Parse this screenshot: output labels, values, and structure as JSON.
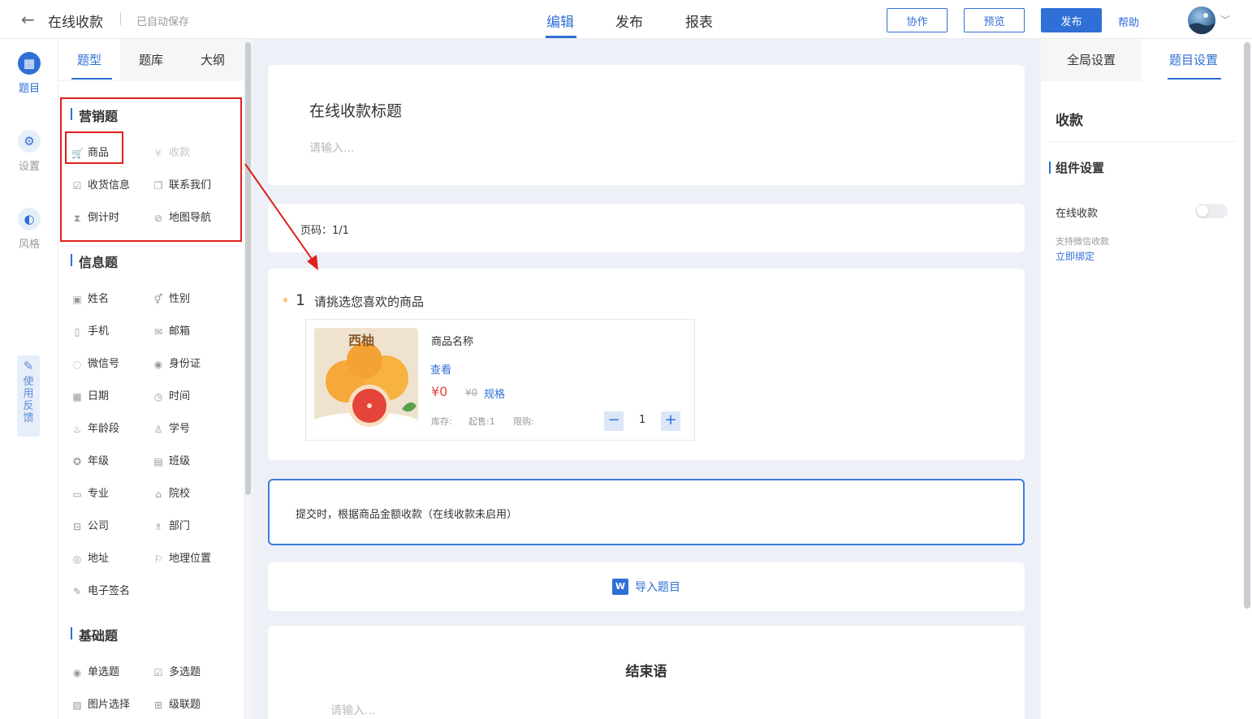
{
  "header": {
    "title": "在线收款",
    "autosave": "已自动保存",
    "tabs": [
      "编辑",
      "发布",
      "报表"
    ],
    "collab_label": "协作",
    "preview_label": "预览",
    "publish_label": "发布",
    "help_label": "帮助"
  },
  "rail": {
    "items": [
      "题目",
      "设置",
      "风格"
    ],
    "feedback": "使用反馈"
  },
  "panel": {
    "tabs": [
      "题型",
      "题库",
      "大纲"
    ],
    "sections": [
      {
        "title": "营销题",
        "items": [
          "商品",
          "收款",
          "收货信息",
          "联系我们",
          "倒计时",
          "地图导航"
        ]
      },
      {
        "title": "信息题",
        "items": [
          "姓名",
          "性别",
          "手机",
          "邮箱",
          "微信号",
          "身份证",
          "日期",
          "时间",
          "年龄段",
          "学号",
          "年级",
          "班级",
          "专业",
          "院校",
          "公司",
          "部门",
          "地址",
          "地理位置",
          "电子签名"
        ]
      },
      {
        "title": "基础题",
        "items": [
          "单选题",
          "多选题",
          "图片选择",
          "级联题"
        ]
      }
    ]
  },
  "form": {
    "title": "在线收款标题",
    "desc_placeholder": "请输入...",
    "page_no": "页码：1/1",
    "question": {
      "star": "*",
      "number": "1",
      "text": "请挑选您喜欢的商品"
    },
    "product": {
      "image_text": "西柚",
      "name": "商品名称",
      "view": "查看",
      "price": "¥0",
      "orig_price": "¥0",
      "spec": "规格",
      "stock": "库存:",
      "min": "起售:1",
      "limit": "限购:",
      "qty": "1"
    },
    "submit_note": "提交时，根据商品金额收款（在线收款未启用）",
    "import_label": "导入题目",
    "end_title": "结束语",
    "end_placeholder": "请输入..."
  },
  "settings": {
    "tabs": [
      "全局设置",
      "题目设置"
    ],
    "heading": "收款",
    "section": "组件设置",
    "toggle_label": "在线收款",
    "toggle_on": false,
    "hint": "支持微信收款",
    "bind_link": "立即绑定"
  },
  "colors": {
    "accent": "#2f6fd6",
    "highlight": "#e0201f",
    "price": "#e84545"
  }
}
